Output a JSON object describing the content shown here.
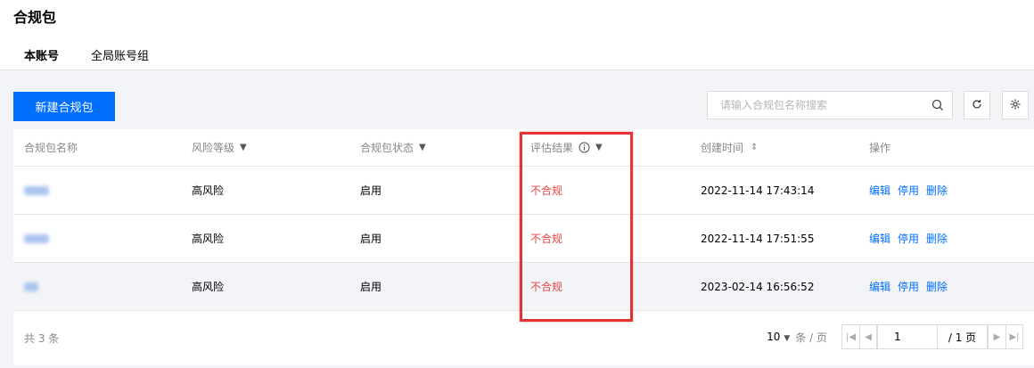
{
  "page": {
    "title": "合规包"
  },
  "tabs": [
    {
      "label": "本账号",
      "active": true
    },
    {
      "label": "全局账号组",
      "active": false
    }
  ],
  "toolbar": {
    "create_label": "新建合规包",
    "search_placeholder": "请输入合规包名称搜索",
    "search_icon": "search-icon",
    "refresh_icon": "refresh-icon",
    "settings_icon": "gear-icon"
  },
  "table": {
    "columns": [
      "合规包名称",
      "风险等级",
      "合规包状态",
      "评估结果",
      "创建时间",
      "操作"
    ],
    "rows": [
      {
        "risk": "高风险",
        "status": "启用",
        "result": "不合规",
        "created": "2022-11-14 17:43:14",
        "actions": [
          "编辑",
          "停用",
          "删除"
        ]
      },
      {
        "risk": "高风险",
        "status": "启用",
        "result": "不合规",
        "created": "2022-11-14 17:51:55",
        "actions": [
          "编辑",
          "停用",
          "删除"
        ]
      },
      {
        "risk": "高风险",
        "status": "启用",
        "result": "不合规",
        "created": "2023-02-14 16:56:52",
        "actions": [
          "编辑",
          "停用",
          "删除"
        ]
      }
    ]
  },
  "footer": {
    "total": "共 3 条",
    "page_size": "10",
    "per_unit": "条 / 页",
    "current_page": "1",
    "page_total": "/ 1 页"
  },
  "colors": {
    "accent": "#006eff",
    "fail": "#e54545",
    "highlight_box": "#e53333"
  }
}
